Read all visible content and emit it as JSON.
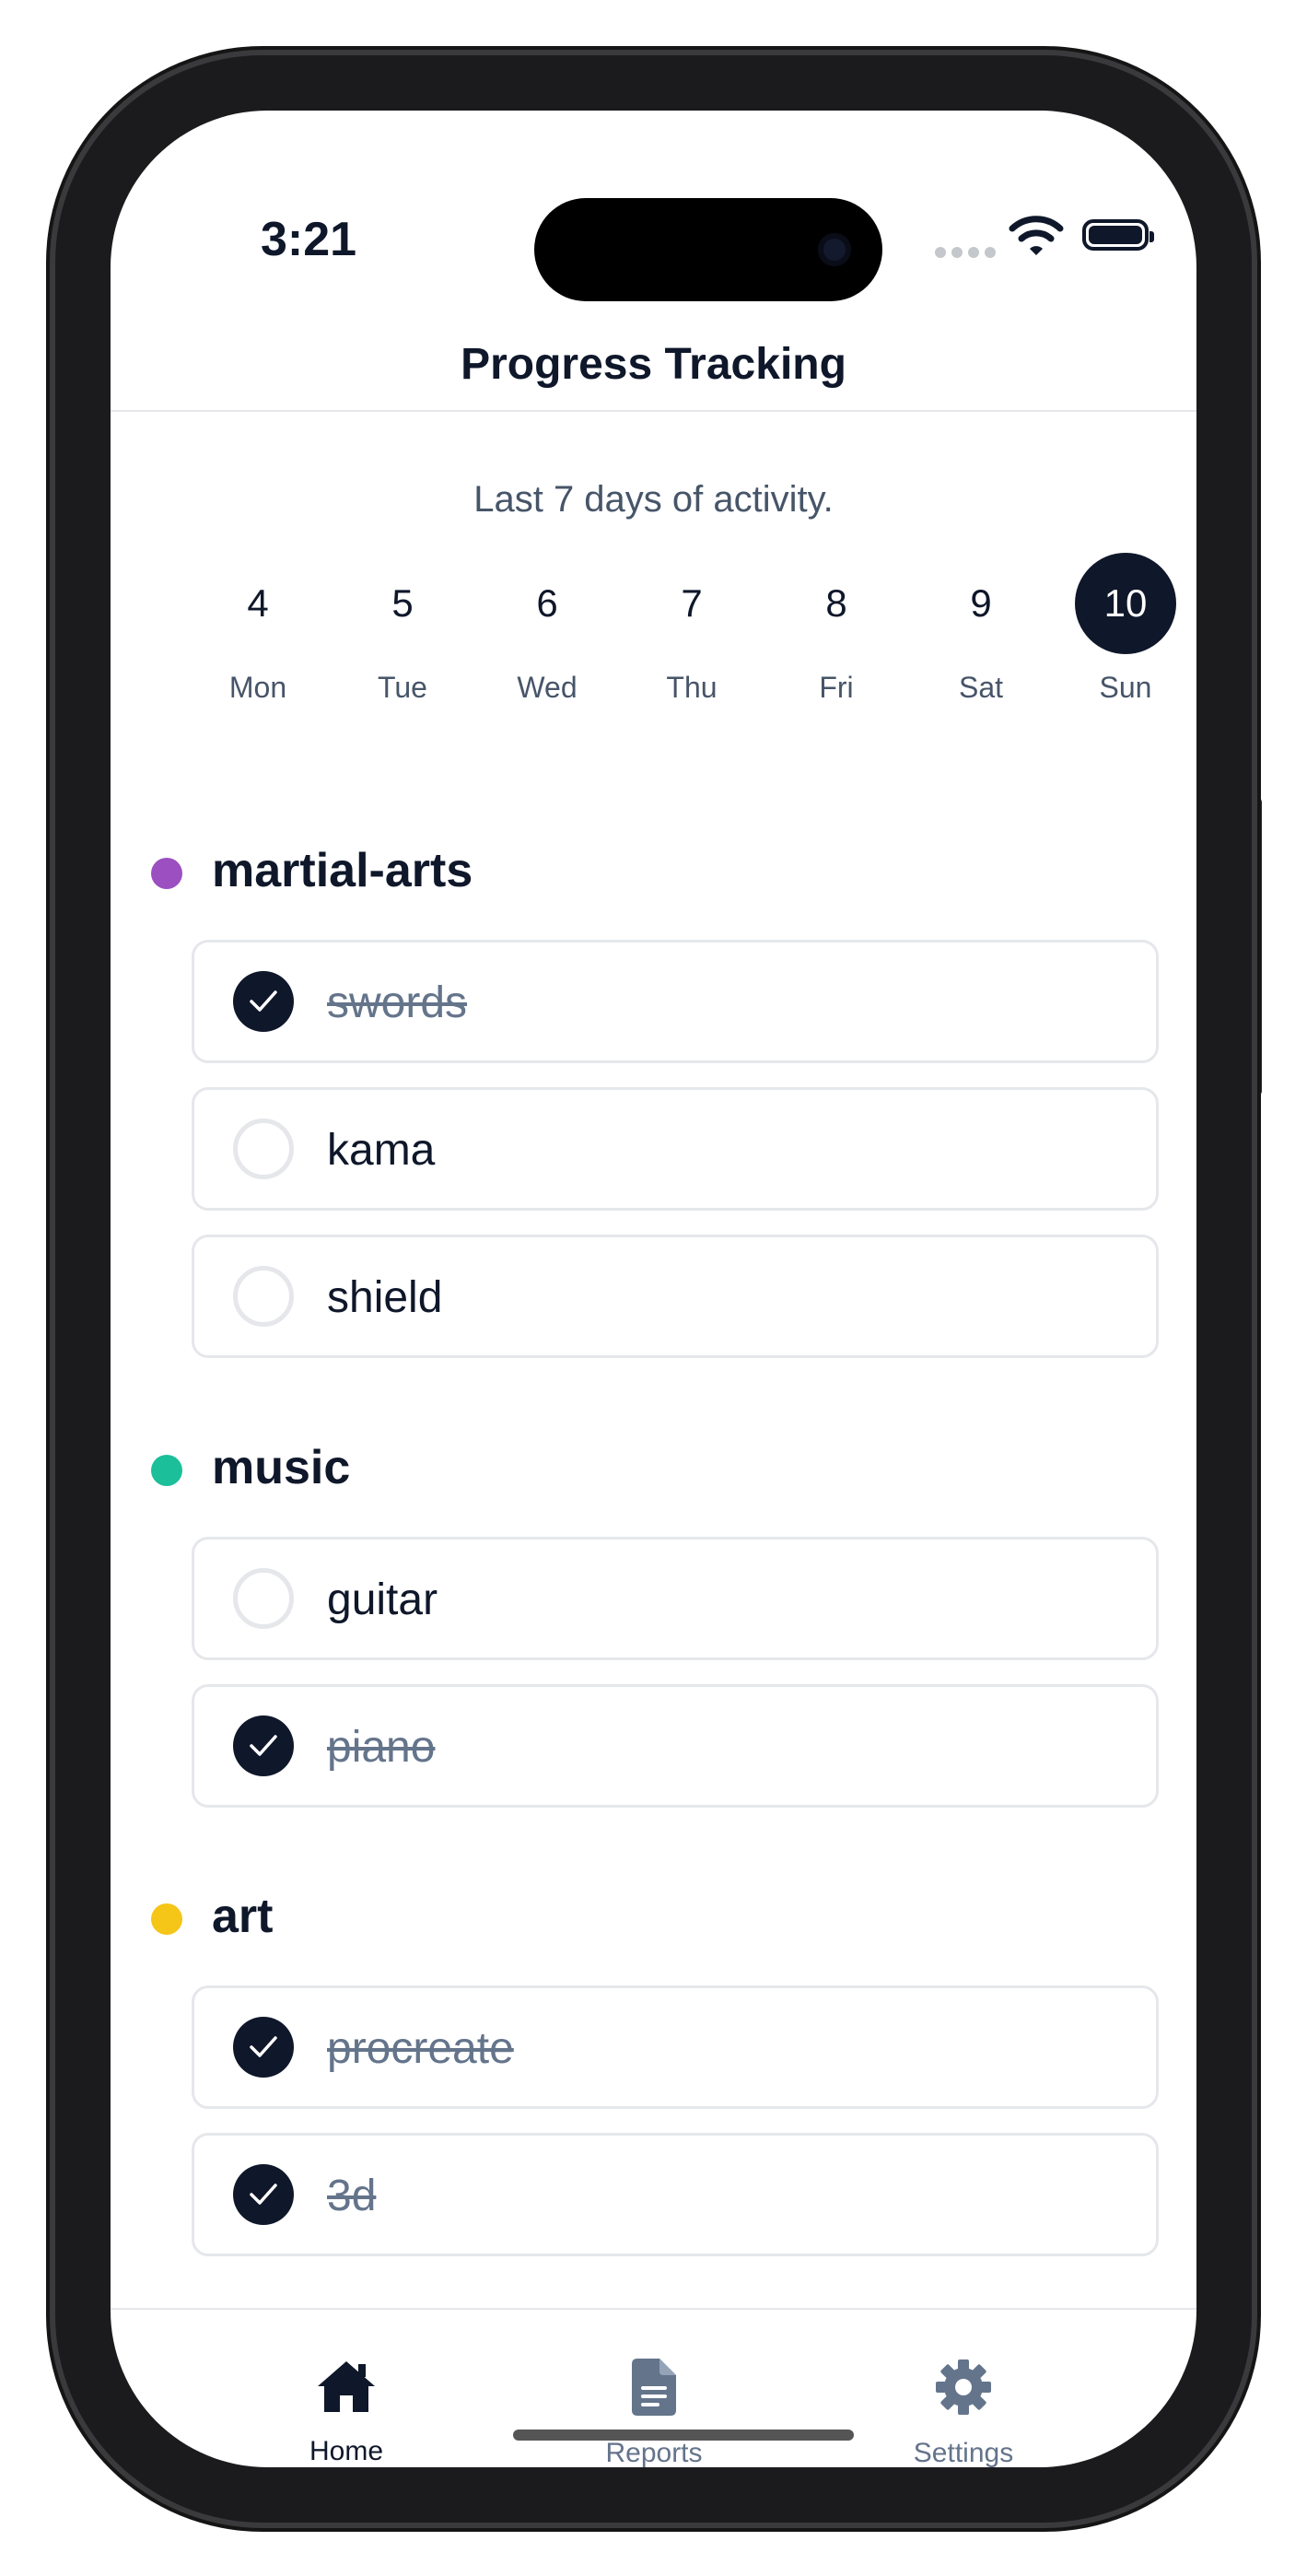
{
  "status_bar": {
    "time": "3:21"
  },
  "header": {
    "title": "Progress Tracking"
  },
  "subtitle": "Last 7 days of activity.",
  "days": [
    {
      "num": "4",
      "label": "Mon",
      "selected": false
    },
    {
      "num": "5",
      "label": "Tue",
      "selected": false
    },
    {
      "num": "6",
      "label": "Wed",
      "selected": false
    },
    {
      "num": "7",
      "label": "Thu",
      "selected": false
    },
    {
      "num": "8",
      "label": "Fri",
      "selected": false
    },
    {
      "num": "9",
      "label": "Sat",
      "selected": false
    },
    {
      "num": "10",
      "label": "Sun",
      "selected": true
    }
  ],
  "categories": [
    {
      "name": "martial-arts",
      "color": "#9b4fc0",
      "tasks": [
        {
          "label": "swords",
          "done": true
        },
        {
          "label": "kama",
          "done": false
        },
        {
          "label": "shield",
          "done": false
        }
      ]
    },
    {
      "name": "music",
      "color": "#1bbf9a",
      "tasks": [
        {
          "label": "guitar",
          "done": false
        },
        {
          "label": "piano",
          "done": true
        }
      ]
    },
    {
      "name": "art",
      "color": "#f5c518",
      "tasks": [
        {
          "label": "procreate",
          "done": true
        },
        {
          "label": "3d",
          "done": true
        }
      ]
    }
  ],
  "tabs": [
    {
      "label": "Home",
      "icon": "home-icon",
      "active": true
    },
    {
      "label": "Reports",
      "icon": "document-icon",
      "active": false
    },
    {
      "label": "Settings",
      "icon": "gear-icon",
      "active": false
    }
  ],
  "colors": {
    "primary": "#0f172a",
    "muted": "#64748b",
    "border": "#e5e7eb"
  }
}
